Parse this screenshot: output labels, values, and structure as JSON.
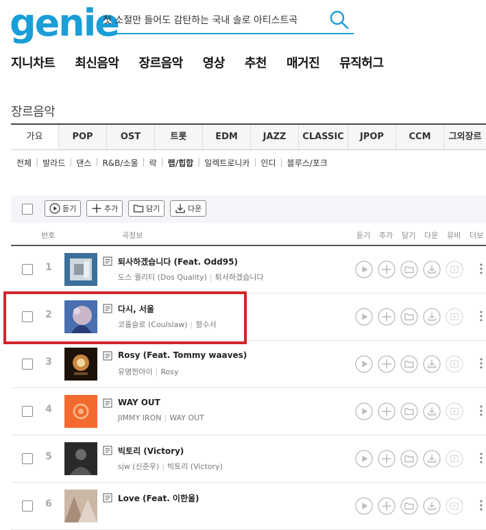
{
  "logo": {
    "letters": [
      "g",
      "e",
      "n",
      "i",
      "e"
    ],
    "colors": [
      "#1a9ed8",
      "#1a9ed8",
      "#1a9ed8",
      "#1a9ed8",
      "#1a9ed8"
    ]
  },
  "search": {
    "value": "첫 소절만 들어도 감탄하는 국내 솔로 아티스트곡",
    "icon": "search-icon"
  },
  "gnb": [
    "지니차트",
    "최신음악",
    "장르음악",
    "영상",
    "추천",
    "매거진",
    "뮤직허그"
  ],
  "page_title": "장르음악",
  "tabs": [
    "가요",
    "POP",
    "OST",
    "트롯",
    "EDM",
    "JAZZ",
    "CLASSIC",
    "JPOP",
    "CCM",
    "그외장르"
  ],
  "subgenres": [
    "전체",
    "발라드",
    "댄스",
    "R&B/소울",
    "락",
    "랩/힙합",
    "일렉트로니카",
    "인디",
    "블루스/포크"
  ],
  "toolbar": {
    "listen": "듣기",
    "add": "추가",
    "keep": "담기",
    "download": "다운"
  },
  "table_header": {
    "num": "번호",
    "info": "곡정보",
    "listen": "듣기",
    "add": "추가",
    "keep": "담기",
    "download": "다운",
    "mv": "뮤비",
    "more": "더보"
  },
  "songs": [
    {
      "num": "1",
      "title": "퇴사하겠습니다 (Feat. Odd95)",
      "artist": "도스 퀄리티 (Dos Quality)",
      "album": "퇴사하겠습니다"
    },
    {
      "num": "2",
      "title": "다시, 서울",
      "artist": "코홀슬로 (Coulslaw)",
      "album": "향수서"
    },
    {
      "num": "3",
      "title": "Rosy (Feat. Tommy waaves)",
      "artist": "유명한아이",
      "album": "Rosy"
    },
    {
      "num": "4",
      "title": "WAY OUT",
      "artist": "JIMMY IRON",
      "album": "WAY OUT"
    },
    {
      "num": "5",
      "title": "빅토리 (Victory)",
      "artist": "sjw (신준우)",
      "album": "빅토리 (Victory)"
    },
    {
      "num": "6",
      "title": "Love (Feat. 이한울)",
      "artist": "",
      "album": ""
    }
  ],
  "colors": {
    "accent": "#1a9ed8",
    "highlight": "#d2232a"
  }
}
